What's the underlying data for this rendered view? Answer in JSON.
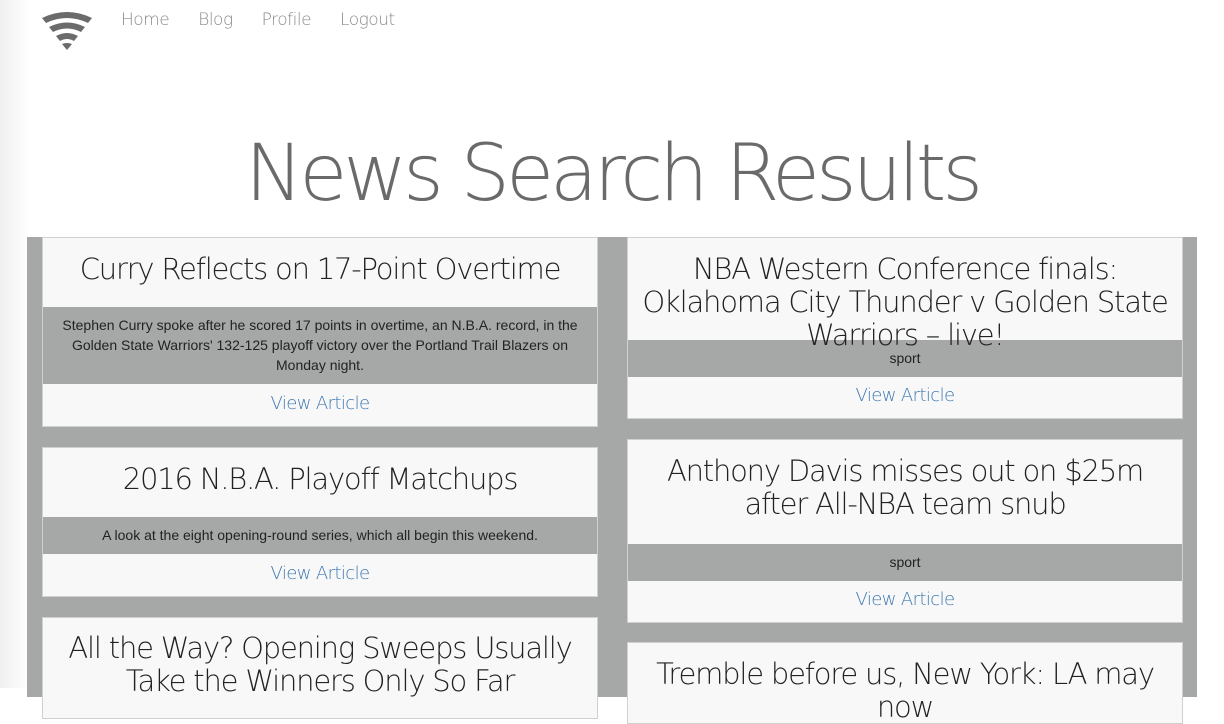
{
  "nav": {
    "logo_icon": "wifi-icon",
    "links": [
      "Home",
      "Blog",
      "Profile",
      "Logout"
    ]
  },
  "page": {
    "title": "News Search Results"
  },
  "colors": {
    "panel_bg": "#a5a8a6",
    "card_bg": "#f8f8f8",
    "link": "#3f79b1",
    "title": "#6a6a6a"
  },
  "articles": {
    "left": [
      {
        "title": "Curry Reflects on 17-Point Overtime",
        "description": "Stephen Curry spoke after he scored 17 points in overtime, an N.B.A. record, in the Golden State Warriors' 132-125 playoff victory over the Portland Trail Blazers on Monday night.",
        "link": "View Article"
      },
      {
        "title": "2016 N.B.A. Playoff Matchups",
        "description": "A look at the eight opening-round series, which all begin this weekend.",
        "link": "View Article"
      },
      {
        "title": "All the Way? Opening Sweeps Usually Take the Winners Only So Far"
      }
    ],
    "right": [
      {
        "title": "NBA Western Conference finals: Oklahoma City Thunder v Golden State Warriors – live!",
        "description": "sport",
        "link": "View Article"
      },
      {
        "title": "Anthony Davis misses out on $25m after All-NBA team snub",
        "description": "sport",
        "link": "View Article"
      },
      {
        "title": "Tremble before us, New York: LA may now"
      }
    ]
  }
}
